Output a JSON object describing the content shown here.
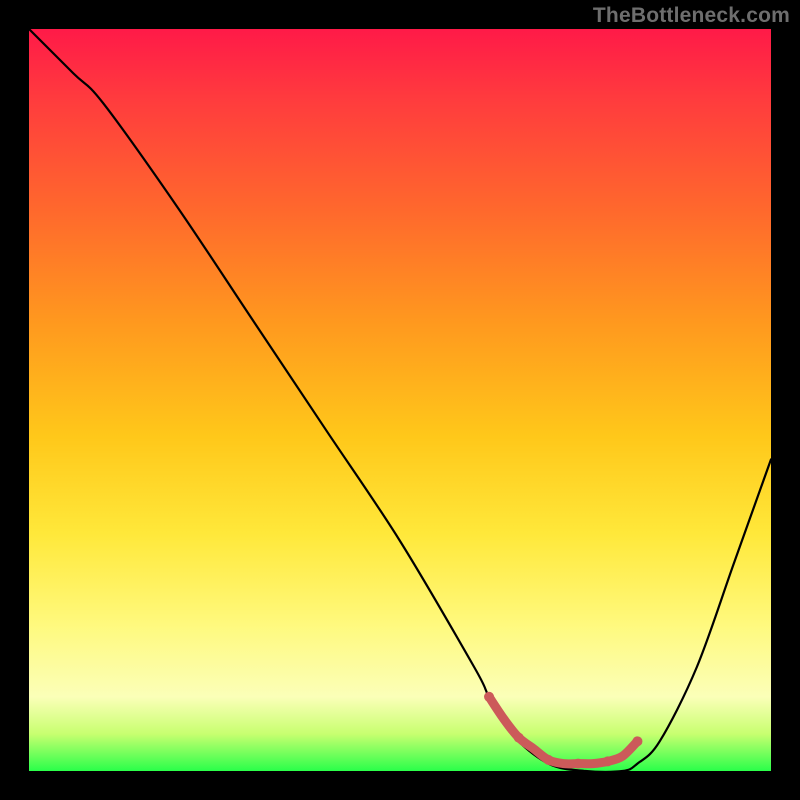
{
  "watermark": "TheBottleneck.com",
  "chart_data": {
    "type": "line",
    "title": "",
    "xlabel": "",
    "ylabel": "",
    "xlim": [
      0,
      100
    ],
    "ylim": [
      0,
      100
    ],
    "series": [
      {
        "name": "bottleneck-curve",
        "color": "#000000",
        "x": [
          0,
          6,
          10,
          20,
          30,
          40,
          50,
          60,
          62,
          65,
          70,
          75,
          80,
          82,
          85,
          90,
          95,
          100
        ],
        "values": [
          100,
          94,
          90,
          76,
          61,
          46,
          31,
          14,
          10,
          5,
          1,
          0,
          0,
          1,
          4,
          14,
          28,
          42
        ]
      },
      {
        "name": "optimal-marker",
        "color": "#cc5a5a",
        "x": [
          62,
          64,
          66,
          68,
          70,
          72,
          74,
          76,
          78,
          80,
          82
        ],
        "values": [
          10,
          7,
          4.5,
          3,
          1.5,
          1,
          1,
          1,
          1.3,
          2,
          4
        ]
      }
    ],
    "background_gradient": {
      "stops": [
        {
          "pos": 0,
          "color": "#ff1a48"
        },
        {
          "pos": 25,
          "color": "#ff6a2c"
        },
        {
          "pos": 55,
          "color": "#ffc81a"
        },
        {
          "pos": 80,
          "color": "#fff97c"
        },
        {
          "pos": 100,
          "color": "#2aff4a"
        }
      ]
    }
  }
}
